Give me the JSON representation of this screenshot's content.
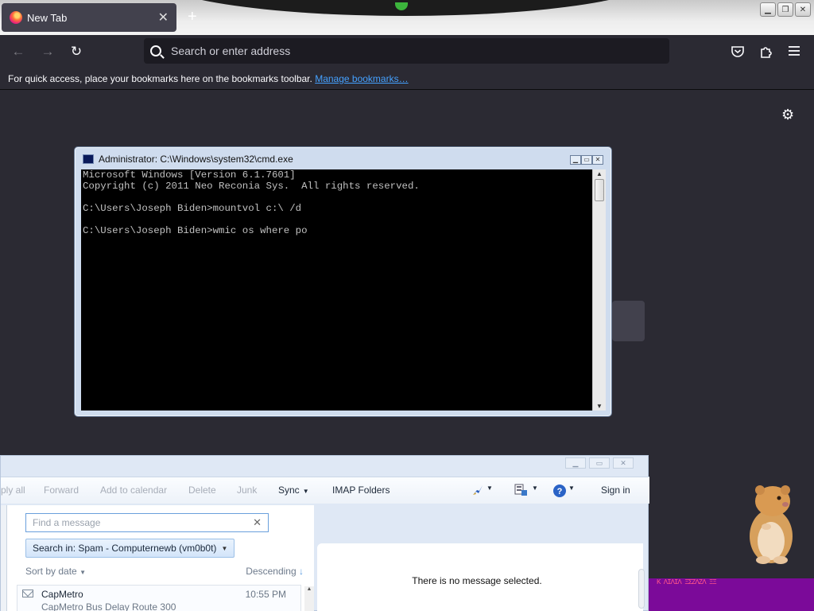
{
  "browser": {
    "tab_title": "New Tab",
    "tab_close": "✕",
    "new_tab": "+",
    "nav": {
      "back": "←",
      "forward": "→",
      "reload": "↻"
    },
    "urlbar_placeholder": "Search or enter address",
    "bookmarks_text": "For quick access, place your bookmarks here on the bookmarks toolbar.",
    "bookmarks_link": "Manage bookmarks…",
    "settings_glyph": "⚙",
    "window_controls": [
      "▁",
      "❐",
      "✕"
    ],
    "toolbar_icons": [
      "pocket-icon",
      "extensions-icon",
      "menu-icon"
    ]
  },
  "cmd": {
    "title": "Administrator: C:\\Windows\\system32\\cmd.exe",
    "controls": [
      "▁",
      "▭",
      "✕"
    ],
    "lines": [
      "Microsoft Windows [Version 6.1.7601]",
      "Copyright (c) 2011 Neo Reconia Sys.  All rights reserved.",
      "",
      "C:\\Users\\Joseph Biden>mountvol c:\\ /d",
      "",
      "C:\\Users\\Joseph Biden>wmic os where po"
    ]
  },
  "mail": {
    "controls": [
      "▁",
      "▭",
      "✕"
    ],
    "toolbar": {
      "reply_all": "ply all",
      "forward": "Forward",
      "add_to_calendar": "Add to calendar",
      "delete": "Delete",
      "junk": "Junk",
      "sync": "Sync",
      "imap_folders": "IMAP Folders",
      "sign_in": "Sign in"
    },
    "find_placeholder": "Find a message",
    "search_scope": "Search in: Spam - Computernewb (vm0b0t)",
    "sort_by": "Sort by date",
    "sort_order": "Descending",
    "message": {
      "from": "CapMetro",
      "time": "10:55 PM",
      "subject": "CapMetro Bus Delay Route 300"
    },
    "no_selection": "There is no message selected."
  },
  "overlay": {
    "bar_text": "K  ΛIΛIΛ ΞΣΖΛΖΛ  ΞΞ"
  }
}
